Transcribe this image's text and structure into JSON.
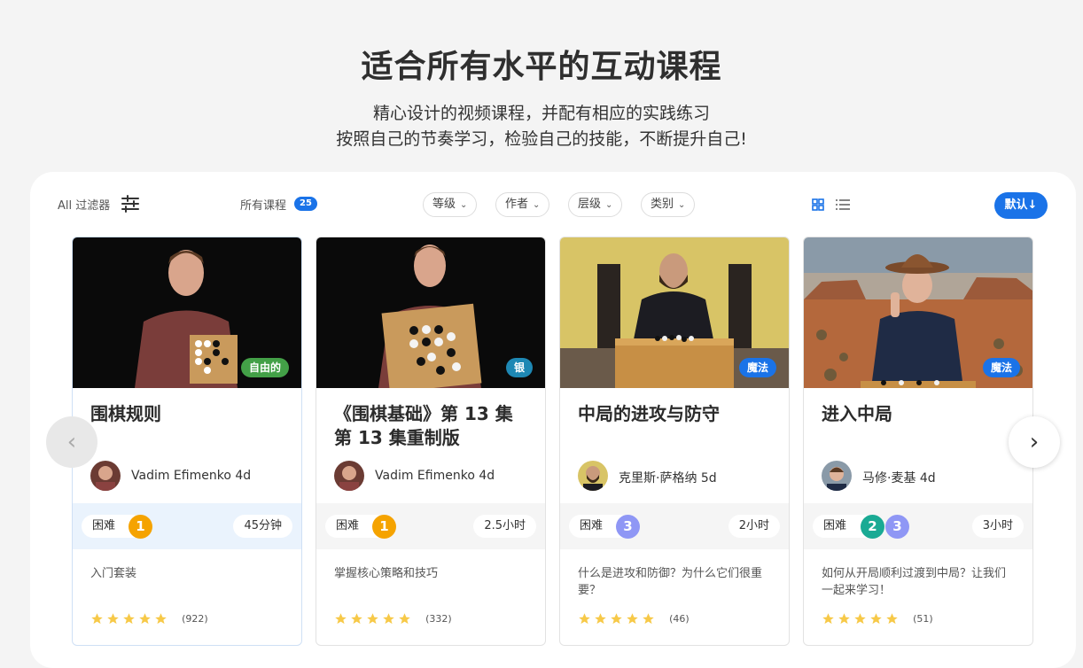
{
  "hero": {
    "title": "适合所有水平的互动课程",
    "subtitle_line1": "精心设计的视频课程，并配有相应的实践练习",
    "subtitle_line2": "按照自己的节奏学习，检验自己的技能，不断提升自己!"
  },
  "toolbar": {
    "filters_label": "All 过滤器",
    "all_courses_label": "所有课程",
    "course_count": "25",
    "dropdowns": [
      "等级",
      "作者",
      "层级",
      "类别"
    ],
    "sort_label": "默认↓"
  },
  "colors": {
    "accent": "#1a73e8",
    "level_orange": "#f5a300",
    "level_purple": "#8f97f5",
    "level_teal": "#1aaa94",
    "tag_green": "#43a047",
    "tag_teal": "#1e88b4",
    "tag_blue": "#1a73e8",
    "star": "#f7c948"
  },
  "cards": [
    {
      "title": "围棋规则",
      "tag": "自由的",
      "author": "Vadim Efimenko 4d",
      "difficulty_label": "困难",
      "levels": [
        "1"
      ],
      "duration": "45分钟",
      "description": "入门套装",
      "rating_count": "(922)",
      "stars": 5
    },
    {
      "title": "《围棋基础》第 13 集 第 13 集重制版",
      "tag": "银",
      "author": "Vadim Efimenko 4d",
      "difficulty_label": "困难",
      "levels": [
        "1"
      ],
      "duration": "2.5小时",
      "description": "掌握核心策略和技巧",
      "rating_count": "(332)",
      "stars": 5
    },
    {
      "title": "中局的进攻与防守",
      "tag": "魔法",
      "author": "克里斯·萨格纳 5d",
      "difficulty_label": "困难",
      "levels": [
        "3"
      ],
      "duration": "2小时",
      "description": "什么是进攻和防御？为什么它们很重要？",
      "rating_count": "(46)",
      "stars": 5
    },
    {
      "title": "进入中局",
      "tag": "魔法",
      "author": "马修·麦基 4d",
      "difficulty_label": "困难",
      "levels": [
        "2",
        "3"
      ],
      "duration": "3小时",
      "description": "如何从开局顺利过渡到中局？让我们一起来学习！",
      "rating_count": "(51)",
      "stars": 5
    }
  ],
  "nav": {
    "prev": "‹",
    "next": "›"
  }
}
